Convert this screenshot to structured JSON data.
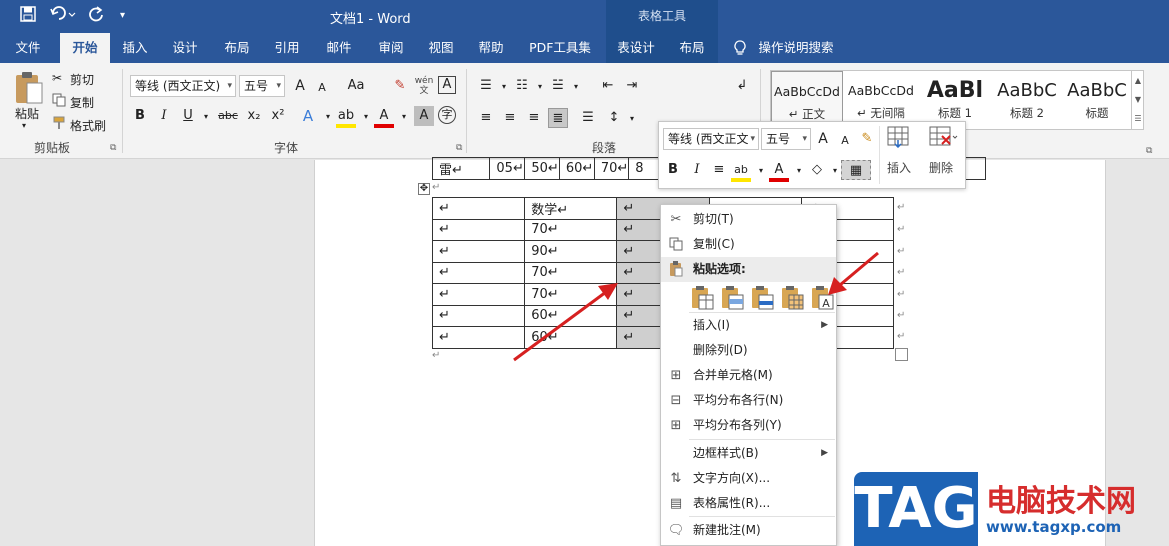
{
  "window": {
    "title": "文档1  -  Word",
    "context_title": "表格工具"
  },
  "quick_access": [
    "save-icon",
    "undo-icon",
    "redo-icon",
    "customize-icon"
  ],
  "tabs": [
    {
      "label": "文件"
    },
    {
      "label": "开始"
    },
    {
      "label": "插入"
    },
    {
      "label": "设计"
    },
    {
      "label": "布局"
    },
    {
      "label": "引用"
    },
    {
      "label": "邮件"
    },
    {
      "label": "审阅"
    },
    {
      "label": "视图"
    },
    {
      "label": "帮助"
    },
    {
      "label": "PDF工具集"
    },
    {
      "label": "表设计"
    },
    {
      "label": "布局"
    }
  ],
  "active_tab": "开始",
  "tell_me": "操作说明搜索",
  "ribbon": {
    "clipboard": {
      "paste": "粘贴",
      "cut": "剪切",
      "copy": "复制",
      "format_painter": "格式刷",
      "label": "剪贴板"
    },
    "font": {
      "font_name": "等线 (西文正文)",
      "font_size": "五号",
      "label": "字体",
      "grow_label": "A",
      "shrink_label": "A",
      "case_label": "Aa",
      "wen_label": "wén文",
      "box_label": "A",
      "bold": "B",
      "italic": "I",
      "underline": "U",
      "strike": "abc",
      "subscript": "x₂",
      "superscript": "x²",
      "effects": "A",
      "highlight": "ab",
      "color": "A",
      "shade": "A",
      "circle": "字"
    },
    "paragraph": {
      "label": "段落"
    },
    "styles": [
      {
        "sample": "AaBbCcDd",
        "name": "↵ 正文"
      },
      {
        "sample": "AaBbCcDd",
        "name": "↵ 无间隔"
      },
      {
        "sample": "AaBl",
        "name": "标题 1"
      },
      {
        "sample": "AaBbC",
        "name": "标题 2"
      },
      {
        "sample": "AaBbC",
        "name": "标题"
      }
    ]
  },
  "mini_toolbar": {
    "font_name": "等线 (西文正文",
    "font_size": "五号",
    "grow": "A",
    "shrink": "A",
    "bold": "B",
    "italic": "I",
    "insert": "插入",
    "delete": "删除"
  },
  "document": {
    "top_row": [
      "雷↵",
      "05↵",
      "50↵",
      "60↵",
      "70↵",
      "8"
    ],
    "header": [
      "↵",
      "数学↵",
      "↵",
      "",
      "↵"
    ],
    "rows": [
      [
        "↵",
        "70↵",
        "↵",
        "",
        ""
      ],
      [
        "↵",
        "90↵",
        "↵",
        "",
        ""
      ],
      [
        "↵",
        "70↵",
        "↵",
        "",
        ""
      ],
      [
        "↵",
        "70↵",
        "↵",
        "",
        ""
      ],
      [
        "↵",
        "60↵",
        "↵",
        "",
        ""
      ],
      [
        "↵",
        "60↵",
        "↵",
        "",
        ""
      ]
    ],
    "row_end_marks": [
      "↵",
      "↵",
      "↵",
      "↵",
      "↵",
      "↵",
      "↵"
    ],
    "para_mark": "↵"
  },
  "context_menu": {
    "items": [
      {
        "label": "剪切(T)",
        "icon": "scissors-icon"
      },
      {
        "label": "复制(C)",
        "icon": "copy-icon"
      },
      {
        "label": "粘贴选项:",
        "icon": "paste-icon"
      },
      {
        "label": "插入(I)",
        "icon": "",
        "submenu": true
      },
      {
        "label": "删除列(D)",
        "icon": ""
      },
      {
        "label": "合并单元格(M)",
        "icon": "merge-cells-icon"
      },
      {
        "label": "平均分布各行(N)",
        "icon": "distribute-rows-icon"
      },
      {
        "label": "平均分布各列(Y)",
        "icon": "distribute-columns-icon"
      },
      {
        "label": "边框样式(B)",
        "icon": "",
        "submenu": true
      },
      {
        "label": "文字方向(X)...",
        "icon": "text-direction-icon"
      },
      {
        "label": "表格属性(R)...",
        "icon": "table-properties-icon"
      },
      {
        "label": "新建批注(M)",
        "icon": "new-comment-icon"
      }
    ],
    "paste_options": [
      "paste-nested-table-icon",
      "paste-merge-table-icon",
      "paste-insert-rows-icon",
      "paste-overwrite-cells-icon",
      "paste-keep-text-only-icon"
    ]
  },
  "watermark": {
    "logo": "TAG",
    "title": "电脑技术网",
    "url": "www.tagxp.com"
  },
  "colors": {
    "word_blue": "#2b579a",
    "context_blue": "#1f4e8c",
    "arrow_red": "#d62020",
    "watermark_blue": "#1d63b5",
    "watermark_red": "#d62d2d"
  }
}
